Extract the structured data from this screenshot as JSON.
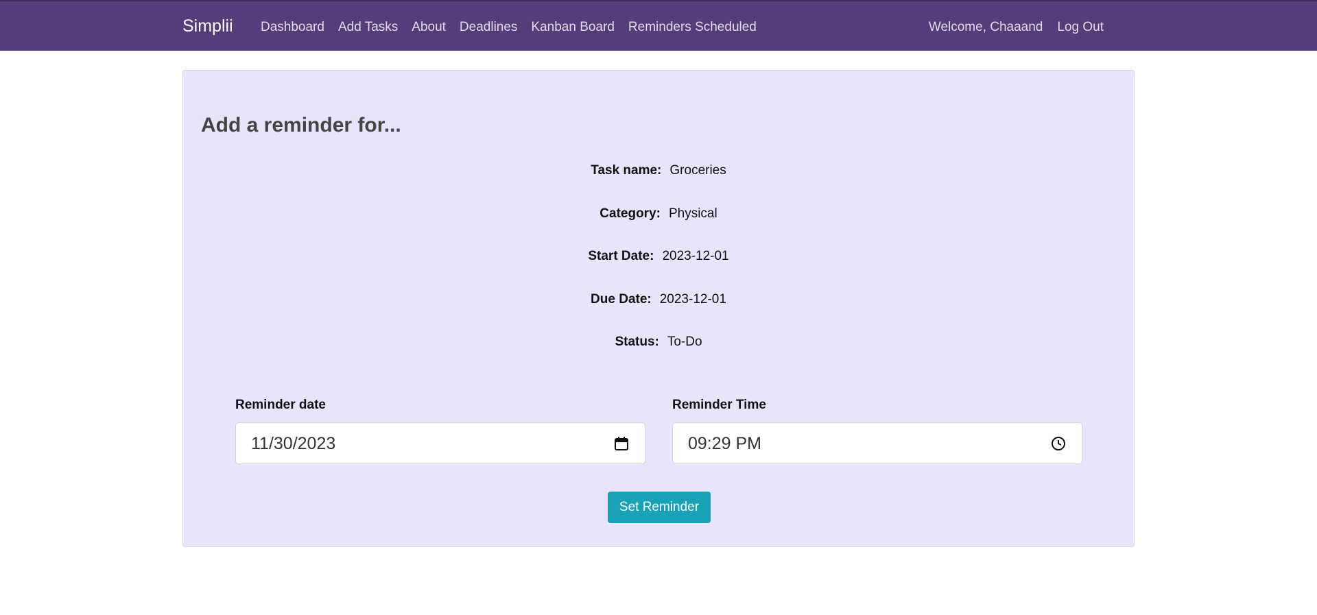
{
  "nav": {
    "brand": "Simplii",
    "links": [
      "Dashboard",
      "Add Tasks",
      "About",
      "Deadlines",
      "Kanban Board",
      "Reminders Scheduled"
    ],
    "welcome": "Welcome, Chaaand",
    "logout": "Log Out"
  },
  "card": {
    "title": "Add a reminder for...",
    "details": [
      {
        "label": "Task name:",
        "value": "Groceries"
      },
      {
        "label": "Category:",
        "value": "Physical"
      },
      {
        "label": "Start Date:",
        "value": "2023-12-01"
      },
      {
        "label": "Due Date:",
        "value": "2023-12-01"
      },
      {
        "label": "Status:",
        "value": "To-Do"
      }
    ],
    "reminder_date": {
      "label": "Reminder date",
      "value": "11/30/2023",
      "icon": "calendar-icon"
    },
    "reminder_time": {
      "label": "Reminder Time",
      "value": "09:29 PM",
      "icon": "clock-icon"
    },
    "submit_label": "Set Reminder"
  },
  "colors": {
    "navbar": "#553c7b",
    "card_bg": "#e7e4fc",
    "button": "#17a2b8"
  }
}
